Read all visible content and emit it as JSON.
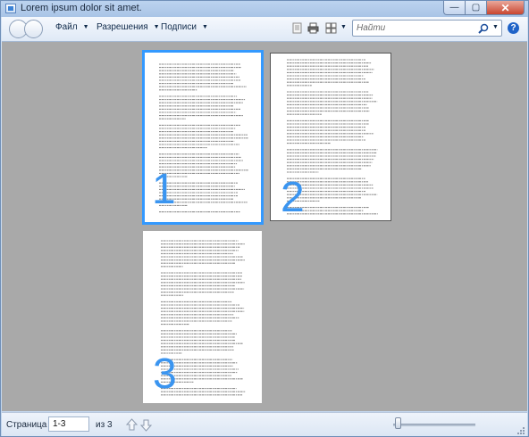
{
  "window": {
    "title": "Lorem ipsum dolor sit amet.",
    "minimize_symbol": "—",
    "maximize_symbol": "▢",
    "close_symbol": "✕"
  },
  "toolbar": {
    "menus": [
      {
        "label": "Файл"
      },
      {
        "label": "Разрешения"
      },
      {
        "label": "Подписи"
      }
    ],
    "icons": [
      "back-icon",
      "forward-icon",
      "document-icon",
      "print-icon",
      "page-layout-icon",
      "search-icon",
      "help-icon"
    ],
    "search_placeholder": "Найти",
    "help_symbol": "?"
  },
  "document": {
    "pages": [
      {
        "number": "1",
        "selected": true
      },
      {
        "number": "2",
        "selected": false
      },
      {
        "number": "3",
        "selected": false
      }
    ],
    "selection_color": "#3399ff",
    "page_number_color": "#3b95f0",
    "background_color": "#a9a9a9"
  },
  "status": {
    "page_label": "Страница",
    "page_value": "1-3",
    "of_label": "из 3",
    "zoom_level": 0.05
  }
}
